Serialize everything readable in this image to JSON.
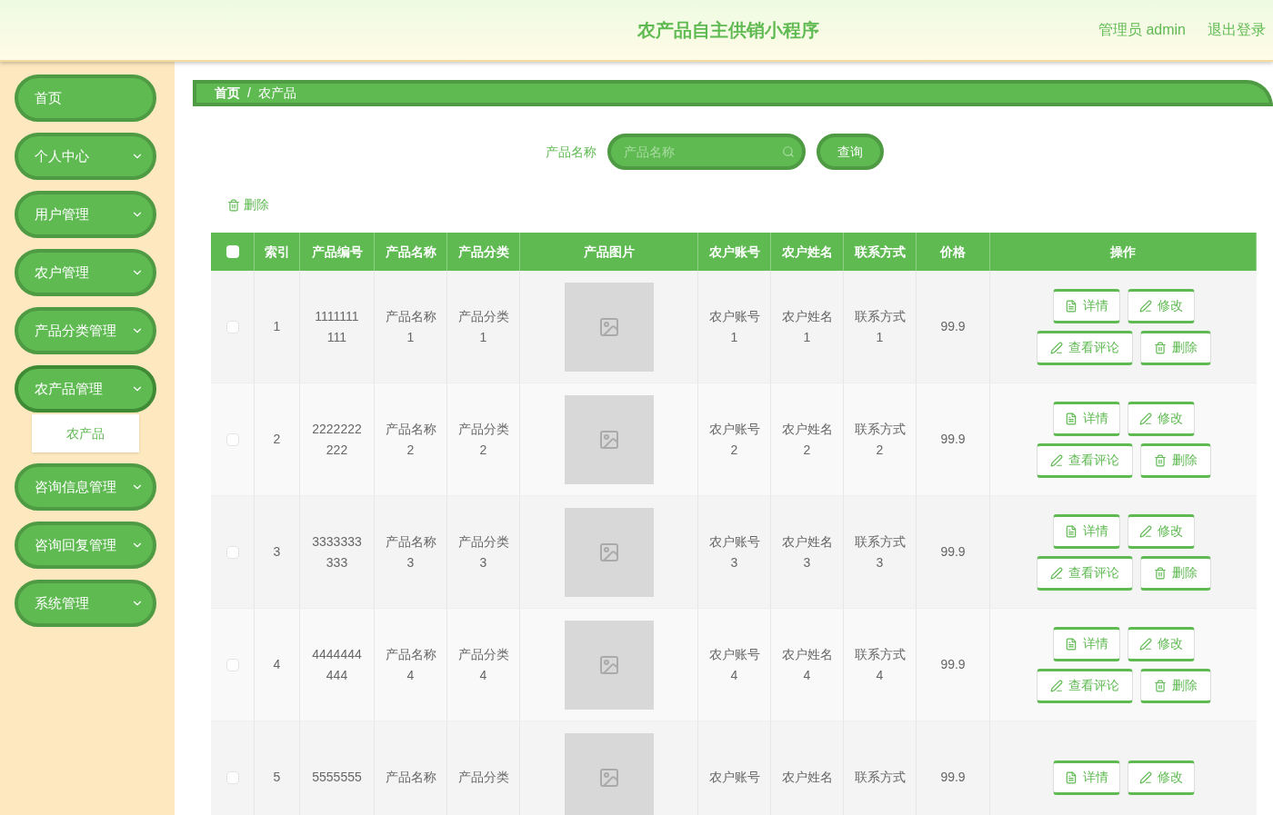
{
  "header": {
    "title": "农产品自主供销小程序",
    "user": "管理员 admin",
    "logout": "退出登录"
  },
  "sidebar": {
    "items": [
      {
        "label": "首页",
        "has_caret": false,
        "expanded": false
      },
      {
        "label": "个人中心",
        "has_caret": true,
        "expanded": false
      },
      {
        "label": "用户管理",
        "has_caret": true,
        "expanded": false
      },
      {
        "label": "农户管理",
        "has_caret": true,
        "expanded": false
      },
      {
        "label": "产品分类管理",
        "has_caret": true,
        "expanded": false
      },
      {
        "label": "农产品管理",
        "has_caret": true,
        "expanded": true,
        "children": [
          {
            "label": "农产品",
            "selected": true
          }
        ]
      },
      {
        "label": "咨询信息管理",
        "has_caret": true,
        "expanded": false
      },
      {
        "label": "咨询回复管理",
        "has_caret": true,
        "expanded": false
      },
      {
        "label": "系统管理",
        "has_caret": true,
        "expanded": false
      }
    ]
  },
  "breadcrumb": {
    "items": [
      "首页",
      "农产品"
    ],
    "separator": "/"
  },
  "search": {
    "label": "产品名称",
    "placeholder": "产品名称",
    "button": "查询"
  },
  "toolbar": {
    "delete": "删除"
  },
  "table": {
    "header_checkbox_checked": false,
    "columns": [
      "索引",
      "产品编号",
      "产品名称",
      "产品分类",
      "产品图片",
      "农户账号",
      "农户姓名",
      "联系方式",
      "价格",
      "操作"
    ],
    "rows": [
      {
        "checked": false,
        "cells": [
          "1",
          "1111111\n111",
          "产品名称\n1",
          "产品分类\n1",
          "",
          "农户账号\n1",
          "农户姓名\n1",
          "联系方式\n1",
          "99.9"
        ],
        "actions": [
          {
            "kind": "detail",
            "label": "详情"
          },
          {
            "kind": "edit",
            "label": "修改"
          },
          {
            "kind": "comments",
            "label": "查看评论"
          },
          {
            "kind": "delete",
            "label": "删除"
          }
        ]
      },
      {
        "checked": false,
        "cells": [
          "2",
          "2222222\n222",
          "产品名称\n2",
          "产品分类\n2",
          "",
          "农户账号\n2",
          "农户姓名\n2",
          "联系方式\n2",
          "99.9"
        ],
        "actions": [
          {
            "kind": "detail",
            "label": "详情"
          },
          {
            "kind": "edit",
            "label": "修改"
          },
          {
            "kind": "comments",
            "label": "查看评论"
          },
          {
            "kind": "delete",
            "label": "删除"
          }
        ]
      },
      {
        "checked": false,
        "cells": [
          "3",
          "3333333\n333",
          "产品名称\n3",
          "产品分类\n3",
          "",
          "农户账号\n3",
          "农户姓名\n3",
          "联系方式\n3",
          "99.9"
        ],
        "actions": [
          {
            "kind": "detail",
            "label": "详情"
          },
          {
            "kind": "edit",
            "label": "修改"
          },
          {
            "kind": "comments",
            "label": "查看评论"
          },
          {
            "kind": "delete",
            "label": "删除"
          }
        ]
      },
      {
        "checked": false,
        "cells": [
          "4",
          "4444444\n444",
          "产品名称\n4",
          "产品分类\n4",
          "",
          "农户账号\n4",
          "农户姓名\n4",
          "联系方式\n4",
          "99.9"
        ],
        "actions": [
          {
            "kind": "detail",
            "label": "详情"
          },
          {
            "kind": "edit",
            "label": "修改"
          },
          {
            "kind": "comments",
            "label": "查看评论"
          },
          {
            "kind": "delete",
            "label": "删除"
          }
        ]
      },
      {
        "checked": false,
        "cells": [
          "5",
          "5555555",
          "产品名称",
          "产品分类",
          "",
          "农户账号",
          "农户姓名",
          "联系方式",
          "99.9"
        ],
        "actions": [
          {
            "kind": "detail",
            "label": "详情"
          },
          {
            "kind": "edit",
            "label": "修改"
          }
        ]
      }
    ]
  }
}
